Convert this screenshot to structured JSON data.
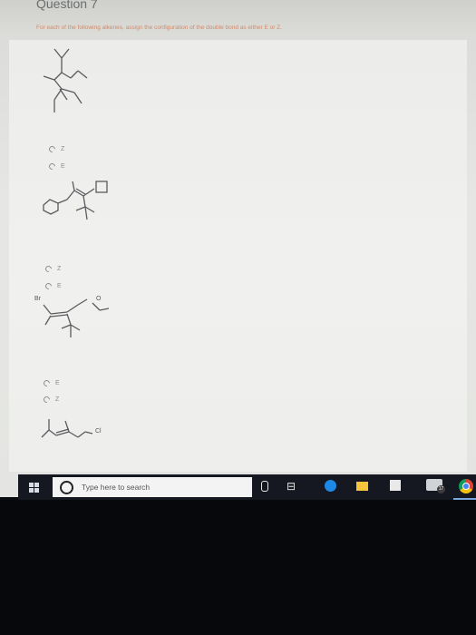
{
  "question": {
    "title": "Question 7",
    "prompt": "For each of the following alkenes, assign the configuration of the double bond as either E or Z."
  },
  "items": [
    {
      "options": [
        "Z",
        "E"
      ]
    },
    {
      "options": [
        "Z",
        "E"
      ],
      "atoms": []
    },
    {
      "options": [
        "E",
        "Z"
      ],
      "atoms": [
        "Br",
        "O"
      ]
    },
    {
      "atoms": [
        "Cl"
      ]
    }
  ],
  "taskbar": {
    "search_placeholder": "Type here to search",
    "badge_count": "17"
  }
}
